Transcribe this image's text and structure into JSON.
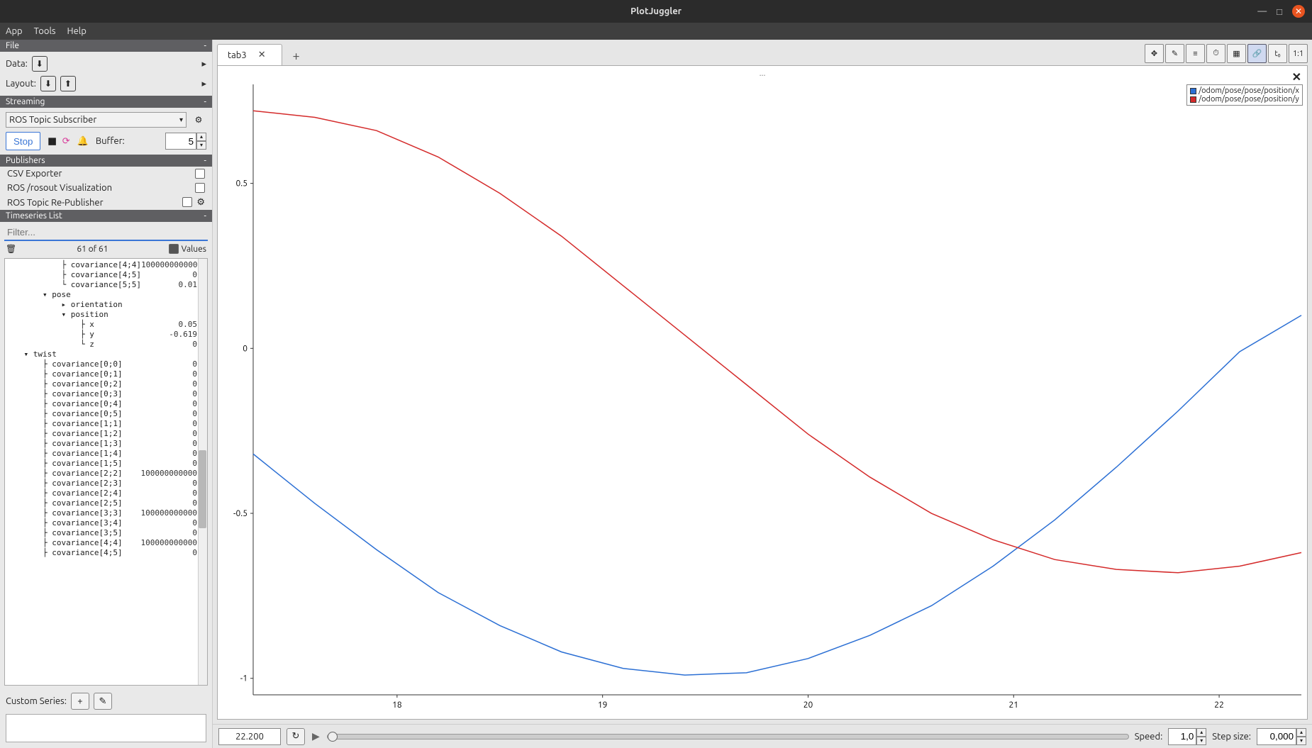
{
  "window": {
    "title": "PlotJuggler"
  },
  "menus": {
    "app": "App",
    "tools": "Tools",
    "help": "Help"
  },
  "file_section": {
    "header": "File",
    "data_label": "Data:",
    "layout_label": "Layout:"
  },
  "streaming": {
    "header": "Streaming",
    "source": "ROS Topic Subscriber",
    "stop": "Stop",
    "buffer_label": "Buffer:",
    "buffer_value": "5"
  },
  "publishers": {
    "header": "Publishers",
    "items": [
      {
        "label": "CSV Exporter"
      },
      {
        "label": "ROS /rosout Visualization"
      },
      {
        "label": "ROS Topic Re-Publisher"
      }
    ]
  },
  "timeseries": {
    "header": "Timeseries List",
    "filter_placeholder": "Filter...",
    "count": "61 of 61",
    "values_label": "Values",
    "rows": [
      {
        "indent": 3,
        "prefix": "├",
        "label": "covariance[4;4]",
        "value": "100000000000"
      },
      {
        "indent": 3,
        "prefix": "├",
        "label": "covariance[4;5]",
        "value": "0"
      },
      {
        "indent": 3,
        "prefix": "└",
        "label": "covariance[5;5]",
        "value": "0.01"
      },
      {
        "indent": 2,
        "prefix": "▾",
        "label": "pose",
        "value": ""
      },
      {
        "indent": 3,
        "prefix": "▸",
        "label": "orientation",
        "value": ""
      },
      {
        "indent": 3,
        "prefix": "▾",
        "label": "position",
        "value": ""
      },
      {
        "indent": 4,
        "prefix": "├",
        "label": "x",
        "value": "0.05"
      },
      {
        "indent": 4,
        "prefix": "├",
        "label": "y",
        "value": "-0.619"
      },
      {
        "indent": 4,
        "prefix": "└",
        "label": "z",
        "value": "0"
      },
      {
        "indent": 1,
        "prefix": "▾",
        "label": "twist",
        "value": ""
      },
      {
        "indent": 2,
        "prefix": "├",
        "label": "covariance[0;0]",
        "value": "0"
      },
      {
        "indent": 2,
        "prefix": "├",
        "label": "covariance[0;1]",
        "value": "0"
      },
      {
        "indent": 2,
        "prefix": "├",
        "label": "covariance[0;2]",
        "value": "0"
      },
      {
        "indent": 2,
        "prefix": "├",
        "label": "covariance[0;3]",
        "value": "0"
      },
      {
        "indent": 2,
        "prefix": "├",
        "label": "covariance[0;4]",
        "value": "0"
      },
      {
        "indent": 2,
        "prefix": "├",
        "label": "covariance[0;5]",
        "value": "0"
      },
      {
        "indent": 2,
        "prefix": "├",
        "label": "covariance[1;1]",
        "value": "0"
      },
      {
        "indent": 2,
        "prefix": "├",
        "label": "covariance[1;2]",
        "value": "0"
      },
      {
        "indent": 2,
        "prefix": "├",
        "label": "covariance[1;3]",
        "value": "0"
      },
      {
        "indent": 2,
        "prefix": "├",
        "label": "covariance[1;4]",
        "value": "0"
      },
      {
        "indent": 2,
        "prefix": "├",
        "label": "covariance[1;5]",
        "value": "0"
      },
      {
        "indent": 2,
        "prefix": "├",
        "label": "covariance[2;2]",
        "value": "100000000000"
      },
      {
        "indent": 2,
        "prefix": "├",
        "label": "covariance[2;3]",
        "value": "0"
      },
      {
        "indent": 2,
        "prefix": "├",
        "label": "covariance[2;4]",
        "value": "0"
      },
      {
        "indent": 2,
        "prefix": "├",
        "label": "covariance[2;5]",
        "value": "0"
      },
      {
        "indent": 2,
        "prefix": "├",
        "label": "covariance[3;3]",
        "value": "100000000000"
      },
      {
        "indent": 2,
        "prefix": "├",
        "label": "covariance[3;4]",
        "value": "0"
      },
      {
        "indent": 2,
        "prefix": "├",
        "label": "covariance[3;5]",
        "value": "0"
      },
      {
        "indent": 2,
        "prefix": "├",
        "label": "covariance[4;4]",
        "value": "100000000000"
      },
      {
        "indent": 2,
        "prefix": "├",
        "label": "covariance[4;5]",
        "value": "0"
      }
    ],
    "custom_label": "Custom Series:"
  },
  "plot": {
    "tab_label": "tab3",
    "title": "...",
    "legend": [
      {
        "name": "/odom/pose/pose/position/x",
        "color": "#2b6fd4"
      },
      {
        "name": "/odom/pose/pose/position/y",
        "color": "#d42a2a"
      }
    ],
    "y_ticks": [
      "0.5",
      "0",
      "-0.5",
      "-1"
    ],
    "x_ticks": [
      "18",
      "19",
      "20",
      "21",
      "22"
    ]
  },
  "toolbar_buttons": {
    "move": "✥",
    "edit": "✎",
    "list": "≡",
    "time": "⏱",
    "grid": "▦",
    "link": "🔗",
    "t0": "t₀",
    "ratio": "1:1"
  },
  "playback": {
    "time": "22.200",
    "speed_label": "Speed:",
    "speed_value": "1,0",
    "step_label": "Step size:",
    "step_value": "0,000"
  },
  "chart_data": {
    "type": "line",
    "title": "...",
    "xlabel": "",
    "ylabel": "",
    "xlim": [
      17.3,
      22.4
    ],
    "ylim": [
      -1.05,
      0.8
    ],
    "series": [
      {
        "name": "/odom/pose/pose/position/x",
        "color": "#2b6fd4",
        "x": [
          17.3,
          17.6,
          17.9,
          18.2,
          18.5,
          18.8,
          19.1,
          19.4,
          19.7,
          20.0,
          20.3,
          20.6,
          20.9,
          21.2,
          21.5,
          21.8,
          22.1,
          22.4
        ],
        "y": [
          -0.32,
          -0.47,
          -0.61,
          -0.74,
          -0.84,
          -0.92,
          -0.97,
          -0.99,
          -0.983,
          -0.94,
          -0.87,
          -0.78,
          -0.66,
          -0.52,
          -0.36,
          -0.19,
          -0.01,
          0.1
        ]
      },
      {
        "name": "/odom/pose/pose/position/y",
        "color": "#d42a2a",
        "x": [
          17.3,
          17.6,
          17.9,
          18.2,
          18.5,
          18.8,
          19.1,
          19.4,
          19.7,
          20.0,
          20.3,
          20.6,
          20.9,
          21.2,
          21.5,
          21.8,
          22.1,
          22.4
        ],
        "y": [
          0.72,
          0.7,
          0.66,
          0.58,
          0.47,
          0.34,
          0.19,
          0.04,
          -0.11,
          -0.26,
          -0.39,
          -0.5,
          -0.58,
          -0.64,
          -0.67,
          -0.68,
          -0.66,
          -0.619
        ]
      }
    ]
  }
}
